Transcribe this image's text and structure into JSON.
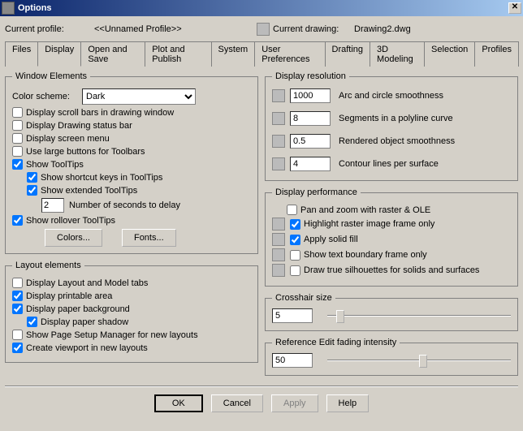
{
  "window": {
    "title": "Options"
  },
  "profile": {
    "label": "Current profile:",
    "value": "<<Unnamed Profile>>",
    "drawing_label": "Current drawing:",
    "drawing_value": "Drawing2.dwg"
  },
  "tabs": {
    "files": "Files",
    "display": "Display",
    "open_save": "Open and Save",
    "plot_publish": "Plot and Publish",
    "system": "System",
    "user_pref": "User Preferences",
    "drafting": "Drafting",
    "modeling": "3D Modeling",
    "selection": "Selection",
    "profiles": "Profiles"
  },
  "window_elements": {
    "legend": "Window Elements",
    "color_scheme_label": "Color scheme:",
    "color_scheme_value": "Dark",
    "scrollbars": "Display scroll bars in drawing window",
    "statusbar": "Display Drawing status bar",
    "screenmenu": "Display screen menu",
    "largebuttons": "Use large buttons for Toolbars",
    "tooltips": "Show ToolTips",
    "shortcut": "Show shortcut keys in ToolTips",
    "extended": "Show extended ToolTips",
    "seconds_value": "2",
    "seconds_label": "Number of seconds to delay",
    "rollover": "Show rollover ToolTips",
    "colors_btn": "Colors...",
    "fonts_btn": "Fonts..."
  },
  "layout_elements": {
    "legend": "Layout elements",
    "tabs": "Display Layout and Model tabs",
    "printable": "Display printable area",
    "paperbg": "Display paper background",
    "shadow": "Display paper shadow",
    "psm": "Show Page Setup Manager for new layouts",
    "viewport": "Create viewport in new layouts"
  },
  "display_resolution": {
    "legend": "Display resolution",
    "arc_value": "1000",
    "arc_label": "Arc and circle smoothness",
    "seg_value": "8",
    "seg_label": "Segments in a polyline curve",
    "rend_value": "0.5",
    "rend_label": "Rendered object smoothness",
    "cont_value": "4",
    "cont_label": "Contour lines per surface"
  },
  "display_performance": {
    "legend": "Display performance",
    "pan": "Pan and zoom with raster & OLE",
    "highlight": "Highlight raster image frame only",
    "solidfill": "Apply solid fill",
    "textframe": "Show text boundary frame only",
    "silhouettes": "Draw true silhouettes for solids and surfaces"
  },
  "crosshair": {
    "legend": "Crosshair size",
    "value": "5"
  },
  "refedit": {
    "legend": "Reference Edit fading intensity",
    "value": "50"
  },
  "buttons": {
    "ok": "OK",
    "cancel": "Cancel",
    "apply": "Apply",
    "help": "Help"
  }
}
